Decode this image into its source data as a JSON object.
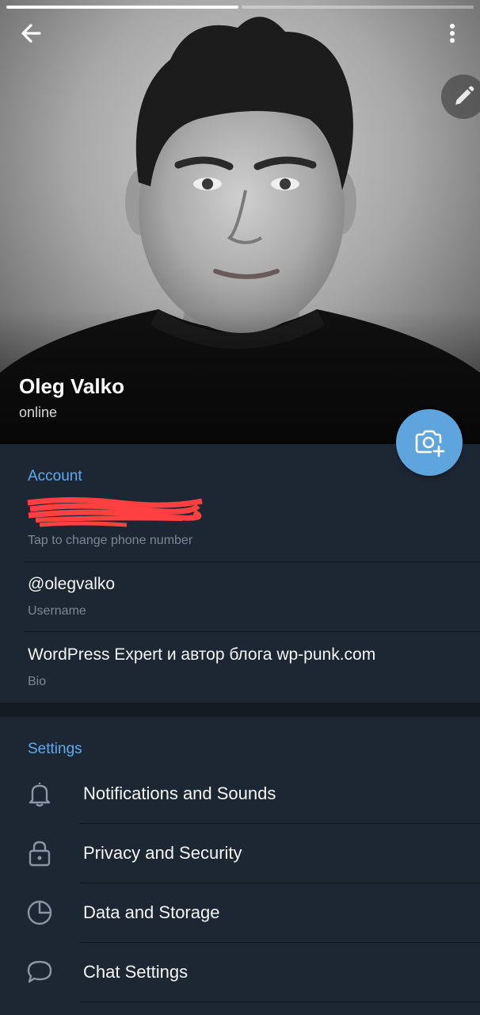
{
  "profile": {
    "name": "Oleg Valko",
    "status": "online"
  },
  "account": {
    "title": "Account",
    "phone_hint": "Tap to change phone number",
    "username": "@olegvalko",
    "username_label": "Username",
    "bio": "WordPress Expert и автор блога wp-punk.com",
    "bio_label": "Bio"
  },
  "settings": {
    "title": "Settings",
    "items": [
      {
        "label": "Notifications and Sounds",
        "icon": "bell-icon"
      },
      {
        "label": "Privacy and Security",
        "icon": "lock-icon"
      },
      {
        "label": "Data and Storage",
        "icon": "pie-chart-icon"
      },
      {
        "label": "Chat Settings",
        "icon": "chat-bubble-icon"
      }
    ]
  },
  "colors": {
    "accent": "#5eaaed",
    "fab": "#5ea5de",
    "background": "#1d2733",
    "redaction": "#ff4040"
  }
}
